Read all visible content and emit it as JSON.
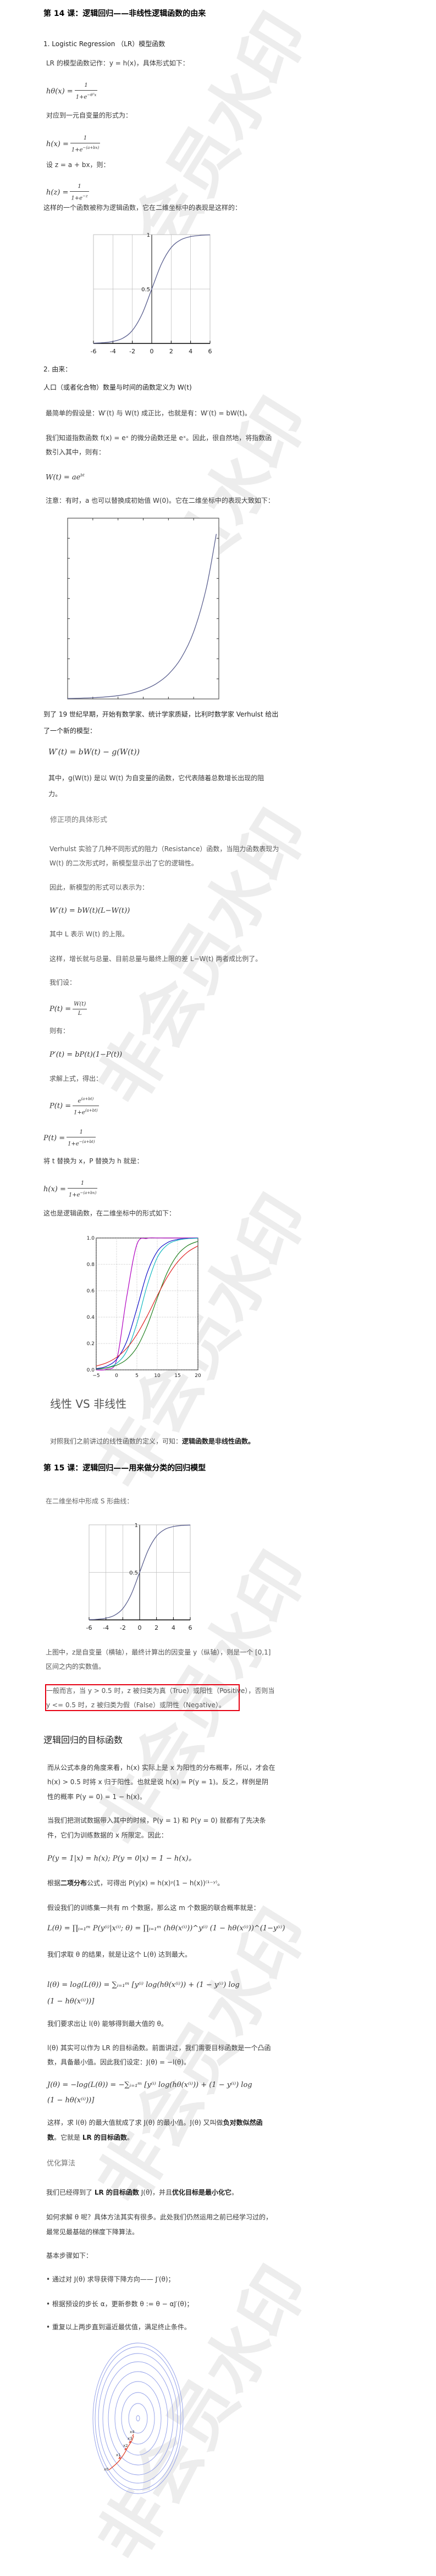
{
  "watermark": "非会员水印",
  "lesson14": {
    "title": "第 14 课：逻辑回归——非线性逻辑函数的由来",
    "s1_heading": "1. Logistic Regression （LR）模型函数",
    "lr_def": "LR 的模型函数记作：y = h(x)，具体形式如下：",
    "f1": {
      "lhs": "hθ(x) =",
      "num": "1",
      "den": "1+e",
      "den_exp": "−θᵀx"
    },
    "one_var": "对应到一元自变量的形式为：",
    "f2": {
      "lhs": "h(x) =",
      "num": "1",
      "den": "1+e",
      "den_exp": "−(a+bx)"
    },
    "set_z": "设 z = a + bx，则：",
    "f3": {
      "lhs": "h(z) =",
      "num": "1",
      "den": "1+e",
      "den_exp": "−z"
    },
    "logistic_desc": "这样的一个函数被称为逻辑函数，它在二维坐标中的表现是这样的：",
    "s2_heading": "2. 由来：",
    "p_pop": "人口（或者化合物）数量与时间的函数定义为 W(t)",
    "p_simple": "最简单的假设是：W′(t) 与 W(t) 成正比，也就是有：W′(t) = bW(t)。",
    "p_exp1": "我们知道指数函数 f(x) = eˣ 的微分函数还是 eˣ。因此，很自然地，将指数函",
    "p_exp2": "数引入其中，则有：",
    "f_w": "W(t) = ae",
    "f_w_exp": "bt",
    "p_note": "注意：有时，a 也可以替换成初始值 W(0)。它在二维坐标中的表现大致如下：",
    "p_19c1": "到了 19 世纪早期，开始有数学家、统计学家质疑，比利时数学家  Verhulst  给出",
    "p_19c2": "了一个新的模型：",
    "f_verhulst": "W′(t) = bW(t) − g(W(t))",
    "p_g1": "其中，g(W(t)) 是以 W(t) 为自变量的函数，它代表随着总数增长出现的阻",
    "p_g2": "力。",
    "sub_correction": "修正项的具体形式",
    "p_res1": "Verhulst 实验了几种不同形式的阻力（Resistance）函数，当阻力函数表现为",
    "p_res2": "W(t) 的二次形式时，新模型显示出了它的逻辑性。",
    "p_thus": "因此，新模型的形式可以表示为：",
    "f_new": "W′(t) = bW(t)(L−W(t))",
    "p_L": "其中 L 表示 W(t) 的上限。",
    "p_prop": "这样，增长就与总量、目前总量与最终上限的差 L−W(t) 两者成比例了。",
    "p_let": "我们设：",
    "f_p": {
      "lhs": "P(t) =",
      "num": "W(t)",
      "den": "L"
    },
    "p_then": "则有：",
    "f_pprime": "P′(t) = bP(t)(1−P(t))",
    "p_solve": "求解上式，得出：",
    "f_psol": {
      "lhs": "P(t) =",
      "num": "e",
      "num_exp": "(a+bt)",
      "den": "1+e",
      "den_exp": "(a+bt)"
    },
    "f_psol2": {
      "lhs": "P(t) =",
      "num": "1",
      "den": "1+e",
      "den_exp": "−(a+bt)"
    },
    "p_replace": "将 t 替换为 x，P 替换为 h 就是：",
    "f_hx": {
      "lhs": "h(x) =",
      "num": "1",
      "den": "1+e",
      "den_exp": "−(a+bx)"
    },
    "p_also": "这也是逻辑函数，在二维坐标中的形式如下：",
    "sub_linear": "线性 VS 非线性",
    "p_compare": "对照我们之前讲过的线性函数的定义，可知：",
    "p_compare_bold": "逻辑函数是非线性函数。"
  },
  "lesson15": {
    "title": "第 15 课：逻辑回归——用来做分类的回归模型",
    "p_s": "在二维坐标中形成 S 形曲线：",
    "p_fig1": "上图中，z是自变量（横轴），最终计算出的因变量 y（纵轴），则是一个 [0,1]",
    "p_fig2": "区间之内的实数值。",
    "hl1": "一般而言，当 y > 0.5 时，z 被归类为真（True）或阳性（Positive），否则当",
    "hl2": "y <= 0.5 时，z 被归类为假（False）或阴性（Negative）。",
    "obj_heading": "逻辑回归的目标函数",
    "p_a1": "而从公式本身的角度来看，h(x) 实际上是 x 为阳性的分布概率，所以，才会在",
    "p_a2": "h(x) > 0.5 时将 x 归于阳性。也就是说 h(x) = P(y = 1)。反之，样例是阴",
    "p_a3": "性的概率 P(y = 0) = 1 − h(x)。",
    "p_b1": "当我们把测试数据带入其中的时候，P(y = 1) 和 P(y = 0) 就都有了先决条",
    "p_b2": "件，它们为训练数据的 x 所限定。因此：",
    "f_cond": "P(y = 1|x) = h(x); P(y = 0|x) = 1 − h(x)。",
    "p_binom_pre": "根据",
    "p_binom_bold": "二项分布",
    "p_binom_post": "公式，可得出 P(y|x) = h(x)ʸ(1 − h(x))⁽¹⁻ʸ⁾。",
    "p_m": "假设我们的训练集一共有 m 个数据，那么这 m 个数据的联合概率就是：",
    "f_L": "L(θ) = ∏ᵢ₌₁ᵐ P(y⁽ⁱ⁾|x⁽ⁱ⁾; θ) = ∏ᵢ₌₁ᵐ (hθ(x⁽ⁱ⁾))^y⁽ⁱ⁾ (1 − hθ(x⁽ⁱ⁾))^(1−y⁽ⁱ⁾)",
    "p_max": "我们求取 θ 的结果，就是让这个 L(θ) 达到最大。",
    "f_l1": "l(θ) = log(L(θ)) = ∑ᵢ₌₁ᵐ [y⁽ⁱ⁾ log(hθ(x⁽ⁱ⁾)) + (1 − y⁽ⁱ⁾) log",
    "f_l2": "(1 − hθ(x⁽ⁱ⁾))]",
    "p_lmax": "我们要求出让 l(θ) 能够得到最大值的 θ。",
    "p_obj1": "l(θ) 其实可以作为 LR 的目标函数。前面讲过，我们需要目标函数是一个凸函",
    "p_obj2": "数，具备最小值。因此我们设定：J(θ) = −l(θ)。",
    "f_J1": "J(θ) = −log(L(θ)) = −∑ᵢ₌₁ᵐ [y⁽ⁱ⁾ log(hθ(x⁽ⁱ⁾)) + (1 − y⁽ⁱ⁾) log",
    "f_J2": "(1 − hθ(x⁽ⁱ⁾))]",
    "p_nll1": "这样，求 l(θ) 的最大值就成了求 J(θ) 的最小值。J(θ) 又叫做",
    "p_nll1_bold": "负对数似然函",
    "p_nll2_bold": "数",
    "p_nll2_mid": "。它就是 ",
    "p_nll2_bold2": "LR 的目标函数",
    "p_nll2_end": "。",
    "opt_heading": "优化算法",
    "p_got_pre": "我们已经得到了 ",
    "p_got_b1": "LR 的目标函数",
    "p_got_mid": " J(θ)，并且",
    "p_got_b2": "优化目标是最小化它",
    "p_got_end": "。",
    "p_how1": "如何求解 θ 呢？具体方法其实有很多。此处我们仍然运用之前已经学习过的，",
    "p_how2": "最常见最基础的梯度下降算法。",
    "p_steps": "基本步骤如下：",
    "steps": [
      "• 通过对 J(θ) 求导获得下降方向—— J′(θ)；",
      "• 根据预设的步长 α，更新参数 θ := θ − αJ′(θ)；",
      "• 重复以上两步直到逼近最优值，满足终止条件。"
    ],
    "contour_labels": [
      "x0",
      "x1",
      "x2",
      "x3",
      "x4"
    ]
  },
  "chart_data": [
    {
      "type": "line",
      "x": [
        -6,
        -5,
        -4,
        -3,
        -2,
        -1,
        0,
        1,
        2,
        3,
        4,
        5,
        6
      ],
      "values": [
        0.0025,
        0.0067,
        0.018,
        0.047,
        0.119,
        0.269,
        0.5,
        0.731,
        0.881,
        0.953,
        0.982,
        0.9933,
        0.9975
      ],
      "xticks": [
        "-6",
        "-4",
        "-2",
        "0",
        "2",
        "4",
        "6"
      ],
      "yticks": [
        "0.5",
        "1"
      ],
      "xlim": [
        -6,
        6
      ],
      "ylim": [
        0,
        1
      ],
      "grid": true,
      "color": "#5a5f8f"
    },
    {
      "type": "line",
      "x": [
        0,
        0.5,
        1,
        1.5,
        2,
        2.5,
        3,
        3.5,
        4,
        4.5,
        5,
        5.5,
        5.9
      ],
      "values": [
        1,
        1.65,
        2.72,
        4.48,
        7.39,
        12.2,
        20.1,
        33.1,
        54.6,
        90,
        148.4,
        244.7,
        365
      ],
      "xlim": [
        0,
        6
      ],
      "ylim": [
        0,
        400
      ],
      "grid": false,
      "color": "#5a5f8f"
    },
    {
      "type": "line",
      "x": [
        -5,
        -2.5,
        0,
        2.5,
        5,
        7.5,
        10,
        12.5,
        15,
        17.5,
        20
      ],
      "series": [
        {
          "color": "#b000c0",
          "values": [
            0.0003,
            0.005,
            0.074,
            0.555,
            0.951,
            0.997,
            1,
            1,
            1,
            1,
            1
          ]
        },
        {
          "color": "#1010c8",
          "values": [
            0.009,
            0.027,
            0.08,
            0.216,
            0.465,
            0.733,
            0.897,
            0.965,
            0.989,
            0.996,
            0.999
          ]
        },
        {
          "color": "#10b8c0",
          "values": [
            0.005,
            0.016,
            0.049,
            0.143,
            0.352,
            0.637,
            0.851,
            0.948,
            0.983,
            0.995,
            0.998
          ]
        },
        {
          "color": "#208020",
          "values": [
            0.006,
            0.015,
            0.035,
            0.08,
            0.171,
            0.332,
            0.544,
            0.741,
            0.873,
            0.943,
            0.975
          ]
        },
        {
          "color": "#e02020",
          "values": [
            0.029,
            0.053,
            0.095,
            0.164,
            0.269,
            0.407,
            0.562,
            0.706,
            0.818,
            0.894,
            0.94
          ]
        }
      ],
      "xticks": [
        "−5",
        "0",
        "5",
        "10",
        "15",
        "20"
      ],
      "yticks": [
        "0.0",
        "0.2",
        "0.4",
        "0.6",
        "0.8",
        "1.0"
      ],
      "xlim": [
        -5,
        20
      ],
      "ylim": [
        0,
        1
      ],
      "grid": true
    },
    {
      "type": "line",
      "x": [
        -6,
        -5,
        -4,
        -3,
        -2,
        -1,
        0,
        1,
        2,
        3,
        4,
        5,
        6
      ],
      "values": [
        0.0025,
        0.0067,
        0.018,
        0.047,
        0.119,
        0.269,
        0.5,
        0.731,
        0.881,
        0.953,
        0.982,
        0.9933,
        0.9975
      ],
      "xticks": [
        "-6",
        "-4",
        "-2",
        "0",
        "2",
        "4",
        "6"
      ],
      "yticks": [
        "0.5",
        "1"
      ],
      "xlim": [
        -6,
        6
      ],
      "ylim": [
        0,
        1
      ],
      "grid": true,
      "color": "#5a5f8f"
    }
  ]
}
